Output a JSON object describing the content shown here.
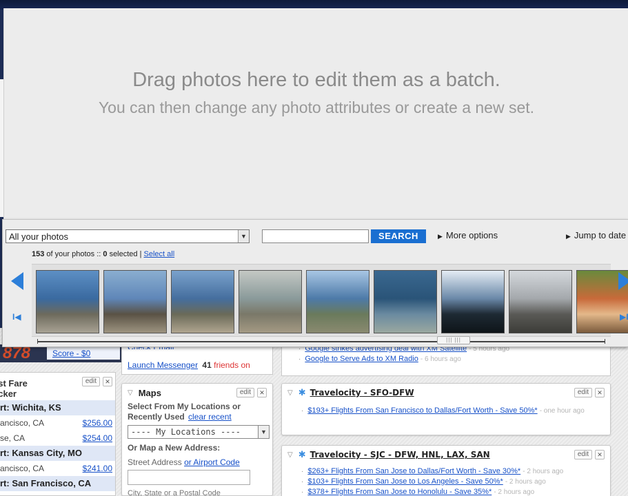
{
  "batch": {
    "title": "Drag photos here to edit them as a batch.",
    "subtitle": "You can then change any photo attributes or create a new set."
  },
  "picker": {
    "filter_value": "All your photos",
    "search_label": "SEARCH",
    "more_options": "More options",
    "jump_to_date": "Jump to date",
    "count": "153",
    "count_suffix": "of your photos ::",
    "selected": "0",
    "selected_suffix": "selected |",
    "select_all": "Select all",
    "scroll_grip": "|||  |||",
    "thumbnails": [
      {
        "name": "coast-cliffs-1",
        "colors": [
          "#5d8fc4",
          "#3a6aa0",
          "#6d6a5c",
          "#a8a294"
        ]
      },
      {
        "name": "family-rocks",
        "colors": [
          "#8aaed0",
          "#5f86b8",
          "#5a5245",
          "#9d9480"
        ]
      },
      {
        "name": "coast-cliffs-2",
        "colors": [
          "#7aa2cc",
          "#456e9e",
          "#6a6a58",
          "#b0a58f"
        ]
      },
      {
        "name": "bixby-bridge",
        "colors": [
          "#c4c8c4",
          "#8a9a9a",
          "#7a7868",
          "#a49a84"
        ]
      },
      {
        "name": "coastline-view",
        "colors": [
          "#a8c6e4",
          "#4d7aa8",
          "#6a7a5c",
          "#8a8a70"
        ]
      },
      {
        "name": "rocky-shore",
        "colors": [
          "#3a6890",
          "#2a5478",
          "#6a8aa0",
          "#9aa8a0"
        ]
      },
      {
        "name": "dark-headland",
        "colors": [
          "#e4ecf4",
          "#6a88a8",
          "#1e2a34",
          "#0e1418"
        ]
      },
      {
        "name": "misty-hills",
        "colors": [
          "#d4d8dc",
          "#a4a8ac",
          "#5a5a56",
          "#3c3c38"
        ]
      },
      {
        "name": "kid-portrait",
        "colors": [
          "#6a8a3c",
          "#c86a3a",
          "#e4b88a",
          "#7a5a3c"
        ]
      }
    ]
  },
  "portal": {
    "score_number": "878",
    "score_label": "Score - $0",
    "check_email": "Check Email",
    "launch_messenger": "Launch Messenger",
    "friends_count": "41",
    "friends_label": "friends on",
    "edit_label": "edit",
    "close_glyph": "✕",
    "fare_tracker": {
      "title": "est Fare\nacker",
      "rows": [
        {
          "type": "city",
          "text": "rt: Wichita, KS"
        },
        {
          "type": "fare",
          "text": "ancisco, CA",
          "price": "$256.00"
        },
        {
          "type": "fare",
          "text": "se, CA",
          "price": "$254.00"
        },
        {
          "type": "city",
          "text": "rt: Kansas City, MO"
        },
        {
          "type": "fare",
          "text": "ancisco, CA",
          "price": "$241.00"
        },
        {
          "type": "city",
          "text": "rt: San Francisco, CA"
        }
      ]
    },
    "maps": {
      "title": "Maps",
      "select_label": "Select From My Locations or Recently Used",
      "clear_recent": "clear recent",
      "locations_value": "---- My Locations ----",
      "new_address_label": "Or Map a New Address:",
      "street_label": "Street Address",
      "airport_link": "or Airport Code",
      "city_label": "City, State or a Postal Code"
    },
    "news": [
      {
        "text": "Google strikes advertising deal with XM Satellite",
        "ago": "- 5 hours ago"
      },
      {
        "text": "Google to Serve Ads to XM Radio",
        "ago": "- 6 hours ago"
      }
    ],
    "travel1": {
      "title": "Travelocity - SFO-DFW",
      "items": [
        {
          "text": "$193+ Flights From San Francisco to Dallas/Fort Worth - Save 50%*",
          "ago": "- one hour ago"
        }
      ]
    },
    "travel2": {
      "title": "Travelocity - SJC - DFW, HNL, LAX, SAN",
      "items": [
        {
          "text": "$263+ Flights From San Jose to Dallas/Fort Worth - Save 30%*",
          "ago": "- 2 hours ago"
        },
        {
          "text": "$103+ Flights From San Jose to Los Angeles - Save 50%*",
          "ago": "- 2 hours ago"
        },
        {
          "text": "$378+ Flights From San Jose to Honolulu - Save 35%*",
          "ago": "- 2 hours ago"
        }
      ]
    }
  }
}
